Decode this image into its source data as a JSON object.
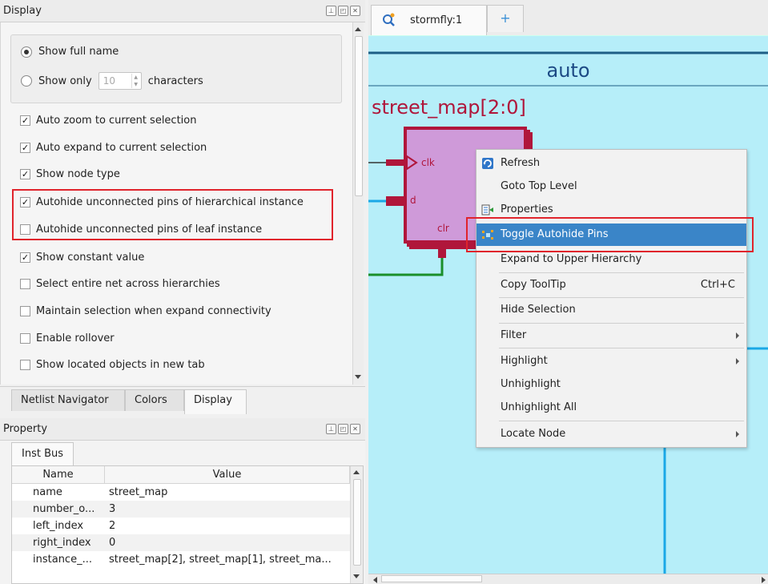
{
  "display_panel": {
    "title": "Display",
    "radio_full_name": "Show full name",
    "radio_only": "Show only",
    "spin_value": "10",
    "characters": "characters",
    "options": [
      {
        "label": "Auto zoom to current selection",
        "checked": true
      },
      {
        "label": "Auto expand to current selection",
        "checked": true
      },
      {
        "label": "Show node type",
        "checked": true
      },
      {
        "label": "Autohide unconnected pins of hierarchical instance",
        "checked": true
      },
      {
        "label": "Autohide unconnected pins of leaf instance",
        "checked": false
      },
      {
        "label": "Show constant value",
        "checked": true
      },
      {
        "label": "Select entire net across hierarchies",
        "checked": false
      },
      {
        "label": "Maintain selection when expand connectivity",
        "checked": false
      },
      {
        "label": "Enable rollover",
        "checked": false
      },
      {
        "label": "Show located objects in new tab",
        "checked": false
      }
    ],
    "check_mark": "✓"
  },
  "bottom_tabs": [
    "Netlist Navigator",
    "Colors",
    "Display"
  ],
  "property_panel": {
    "title": "Property",
    "tab": "Inst Bus",
    "columns": [
      "Name",
      "Value"
    ],
    "rows": [
      {
        "name": "name",
        "value": "street_map"
      },
      {
        "name": "number_o...",
        "value": "3"
      },
      {
        "name": "left_index",
        "value": "2"
      },
      {
        "name": "right_index",
        "value": "0"
      },
      {
        "name": "instance_...",
        "value": "street_map[2], street_map[1], street_ma..."
      }
    ]
  },
  "viewer": {
    "tab_label": "stormfly:1",
    "plus": "+",
    "auto_label": "auto",
    "block_title": "street_map[2:0]",
    "pins": {
      "clk": "clk",
      "d": "d",
      "clr": "clr"
    }
  },
  "context_menu": {
    "refresh": "Refresh",
    "goto_top": "Goto Top Level",
    "properties": "Properties",
    "toggle_autohide": "Toggle Autohide Pins",
    "expand_upper": "Expand to Upper Hierarchy",
    "copy_tooltip": "Copy ToolTip",
    "copy_shortcut": "Ctrl+C",
    "hide_selection": "Hide Selection",
    "filter": "Filter",
    "highlight": "Highlight",
    "unhighlight": "Unhighlight",
    "unhighlight_all": "Unhighlight All",
    "locate_node": "Locate Node"
  },
  "colors": {
    "canvas": "#b6eef9",
    "block_fill": "#cf9ad9",
    "block_border": "#b0163b",
    "wire_blue": "#1aa8e6",
    "wire_green": "#1a8f2a",
    "highlight": "#3a85c8",
    "annotation_red": "#e0242c"
  }
}
